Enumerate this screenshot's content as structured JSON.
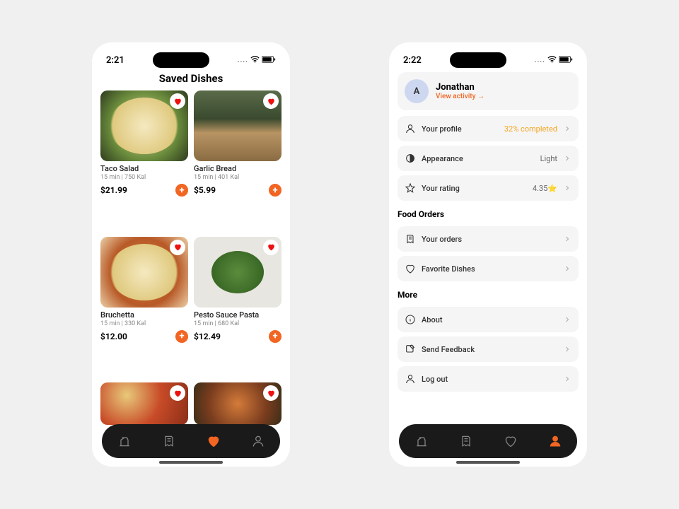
{
  "colors": {
    "accent": "#f26522",
    "warning": "#f5a623"
  },
  "left": {
    "status": {
      "time": "2:21"
    },
    "title": "Saved Dishes",
    "dishes": [
      {
        "name": "Taco Salad",
        "meta": "15 min | 750 Kal",
        "price": "$21.99"
      },
      {
        "name": "Garlic Bread",
        "meta": "15 min | 401 Kal",
        "price": "$5.99"
      },
      {
        "name": "Bruchetta",
        "meta": "15 min | 330 Kal",
        "price": "$12.00"
      },
      {
        "name": "Pesto Sauce Pasta",
        "meta": "15 min | 680 Kal",
        "price": "$12.49"
      }
    ],
    "tabbar": {
      "active": "favorites"
    }
  },
  "right": {
    "status": {
      "time": "2:22"
    },
    "user": {
      "initial": "A",
      "name": "Jonathan",
      "link": "View activity →"
    },
    "settings": [
      {
        "icon": "user",
        "label": "Your profile",
        "value": "32% completed",
        "value_style": "orange"
      },
      {
        "icon": "half-circle",
        "label": "Appearance",
        "value": "Light"
      },
      {
        "icon": "star",
        "label": "Your rating",
        "value": "4.35⭐"
      }
    ],
    "sections": [
      {
        "title": "Food Orders",
        "rows": [
          {
            "icon": "receipt",
            "label": "Your orders"
          },
          {
            "icon": "heart",
            "label": "Favorite Dishes"
          }
        ]
      },
      {
        "title": "More",
        "rows": [
          {
            "icon": "info",
            "label": "About"
          },
          {
            "icon": "feedback",
            "label": "Send Feedback"
          },
          {
            "icon": "user",
            "label": "Log out"
          }
        ]
      }
    ],
    "tabbar": {
      "active": "profile"
    }
  }
}
